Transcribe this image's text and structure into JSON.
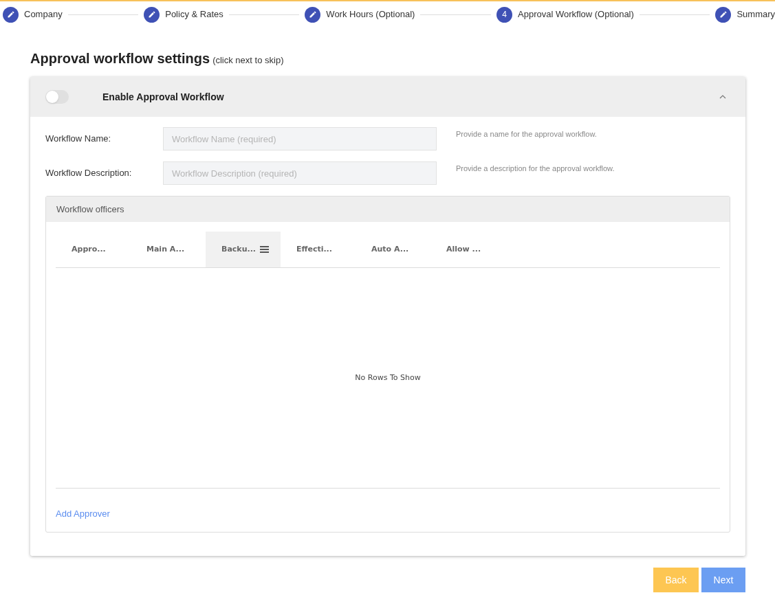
{
  "stepper": [
    {
      "label": "Company",
      "kind": "edit"
    },
    {
      "label": "Policy & Rates",
      "kind": "edit"
    },
    {
      "label": "Work Hours (Optional)",
      "kind": "edit"
    },
    {
      "label": "Approval Workflow (Optional)",
      "kind": "number",
      "number": "4"
    },
    {
      "label": "Summary",
      "kind": "edit"
    }
  ],
  "title": "Approval workflow settings",
  "subtitle": "(click next to skip)",
  "panel": {
    "toggle_label": "Enable Approval Workflow",
    "on": false,
    "expanded": true
  },
  "fields": [
    {
      "label": "Workflow Name:",
      "placeholder": "Workflow Name (required)",
      "help": "Provide a name for the approval workflow."
    },
    {
      "label": "Workflow Description:",
      "placeholder": "Workflow Description (required)",
      "help": "Provide a description for the approval workflow."
    }
  ],
  "officers": {
    "title": "Workflow officers",
    "columns": [
      {
        "label": "Appro...",
        "selected": false
      },
      {
        "label": "Main A...",
        "selected": false
      },
      {
        "label": "Backu...",
        "selected": true
      },
      {
        "label": "Effecti...",
        "selected": false
      },
      {
        "label": "Auto A...",
        "selected": false
      },
      {
        "label": "Allow ...",
        "selected": false
      }
    ],
    "empty_text": "No Rows To Show",
    "add_link": "Add Approver"
  },
  "buttons": [
    {
      "label": "Back",
      "kind": "back"
    },
    {
      "label": "Next",
      "kind": "next"
    }
  ]
}
